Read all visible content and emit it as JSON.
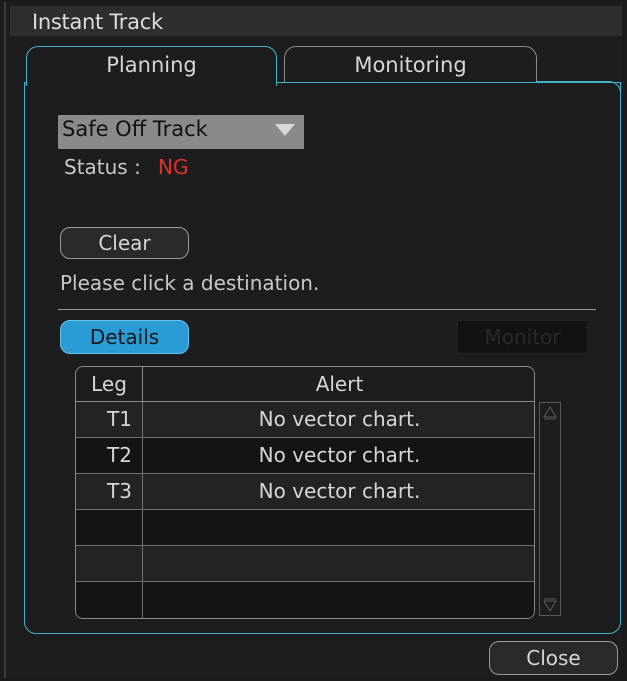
{
  "window": {
    "title": "Instant Track"
  },
  "tabs": [
    {
      "label": "Planning",
      "active": true
    },
    {
      "label": "Monitoring",
      "active": false
    }
  ],
  "planning": {
    "mode_select": {
      "value": "Safe Off Track"
    },
    "status_label": "Status :",
    "status_value": "NG",
    "clear_label": "Clear",
    "hint": "Please click a destination.",
    "details_label": "Details",
    "monitor_label": "Monitor",
    "table": {
      "columns": [
        "Leg",
        "Alert"
      ],
      "rows": [
        {
          "leg": "T1",
          "alert": "No vector chart."
        },
        {
          "leg": "T2",
          "alert": "No vector chart."
        },
        {
          "leg": "T3",
          "alert": "No vector chart."
        },
        {
          "leg": "",
          "alert": ""
        },
        {
          "leg": "",
          "alert": ""
        },
        {
          "leg": "",
          "alert": ""
        }
      ]
    }
  },
  "footer": {
    "close_label": "Close"
  },
  "colors": {
    "accent": "#3fb3c8",
    "status_ng": "#e0302a",
    "details_bg": "#2a9bd4"
  }
}
